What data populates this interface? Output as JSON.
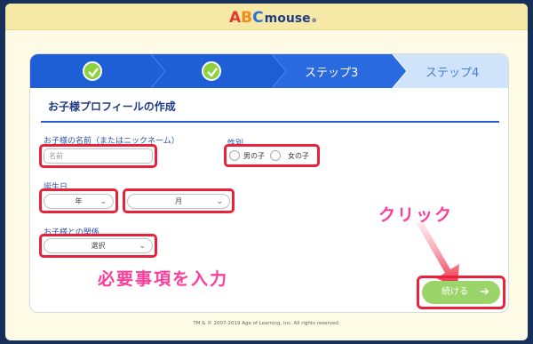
{
  "logo": {
    "a": "A",
    "b": "B",
    "c": "C",
    "mouse": "mouse",
    "tm": "®"
  },
  "steps": [
    {
      "state": "done",
      "icon": "check-icon"
    },
    {
      "state": "done",
      "icon": "check-icon"
    },
    {
      "state": "current",
      "label": "ステップ3"
    },
    {
      "state": "upcoming",
      "label": "ステップ4"
    }
  ],
  "colors": {
    "step_done": "#1f5fd6",
    "step_current": "#2a6ae0",
    "step_upcoming": "#cfe3fb",
    "check": "#8cd23c",
    "highlight": "#e8223a",
    "callout": "#ff3b9a",
    "next_button": "#9bd56a"
  },
  "form": {
    "title": "お子様プロフィールの作成",
    "name_label": "お子様の名前（またはニックネーム）",
    "name_placeholder": "名前",
    "gender_label": "性別",
    "gender_options": [
      "男の子",
      "女の子"
    ],
    "birthday_label": "誕生日",
    "year_value": "年",
    "month_value": "月",
    "relation_label": "お子様との関係",
    "relation_value": "選択",
    "next_label": "続ける"
  },
  "annotations": {
    "input_callout": "必要事項を入力",
    "click_callout": "クリック"
  },
  "footer": "TM & © 2007-2019 Age of Learning, Inc. All rights reserved."
}
